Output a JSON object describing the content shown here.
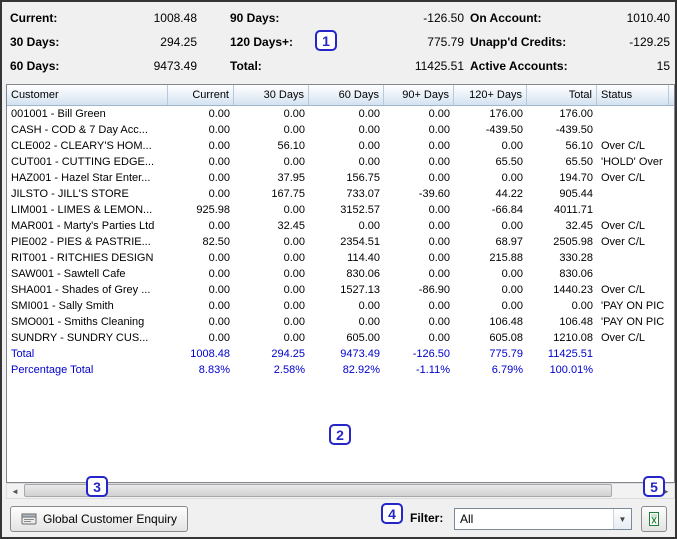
{
  "summary": {
    "items": [
      {
        "label": "Current:",
        "value": "1008.48"
      },
      {
        "label": "90 Days:",
        "value": "-126.50"
      },
      {
        "label": "On Account:",
        "value": "1010.40"
      },
      {
        "label": "30 Days:",
        "value": "294.25"
      },
      {
        "label": "120 Days+:",
        "value": "775.79"
      },
      {
        "label": "Unapp'd Credits:",
        "value": "-129.25"
      },
      {
        "label": "60 Days:",
        "value": "9473.49"
      },
      {
        "label": "Total:",
        "value": "11425.51"
      },
      {
        "label": "Active Accounts:",
        "value": "15"
      }
    ]
  },
  "table": {
    "columns": [
      "Customer",
      "Current",
      "30 Days",
      "60 Days",
      "90+ Days",
      "120+ Days",
      "Total",
      "Status"
    ],
    "keys": [
      "customer",
      "current",
      "d30",
      "d60",
      "d90",
      "d120",
      "total",
      "status"
    ],
    "aligns": [
      "left",
      "right",
      "right",
      "right",
      "right",
      "right",
      "right",
      "left"
    ],
    "rows": [
      {
        "customer": "001001 - Bill Green",
        "current": "0.00",
        "d30": "0.00",
        "d60": "0.00",
        "d90": "0.00",
        "d120": "176.00",
        "total": "176.00",
        "status": ""
      },
      {
        "customer": "CASH   - COD & 7 Day Acc...",
        "current": "0.00",
        "d30": "0.00",
        "d60": "0.00",
        "d90": "0.00",
        "d120": "-439.50",
        "total": "-439.50",
        "status": ""
      },
      {
        "customer": "CLE002 - CLEARY'S HOM...",
        "current": "0.00",
        "d30": "56.10",
        "d60": "0.00",
        "d90": "0.00",
        "d120": "0.00",
        "total": "56.10",
        "status": "Over C/L"
      },
      {
        "customer": "CUT001 - CUTTING EDGE...",
        "current": "0.00",
        "d30": "0.00",
        "d60": "0.00",
        "d90": "0.00",
        "d120": "65.50",
        "total": "65.50",
        "status": "'HOLD' Over"
      },
      {
        "customer": "HAZ001 - Hazel Star Enter...",
        "current": "0.00",
        "d30": "37.95",
        "d60": "156.75",
        "d90": "0.00",
        "d120": "0.00",
        "total": "194.70",
        "status": "Over C/L"
      },
      {
        "customer": "JILSTO - JILL'S STORE",
        "current": "0.00",
        "d30": "167.75",
        "d60": "733.07",
        "d90": "-39.60",
        "d120": "44.22",
        "total": "905.44",
        "status": ""
      },
      {
        "customer": "LIM001 - LIMES & LEMON...",
        "current": "925.98",
        "d30": "0.00",
        "d60": "3152.57",
        "d90": "0.00",
        "d120": "-66.84",
        "total": "4011.71",
        "status": ""
      },
      {
        "customer": "MAR001 - Marty's Parties Ltd",
        "current": "0.00",
        "d30": "32.45",
        "d60": "0.00",
        "d90": "0.00",
        "d120": "0.00",
        "total": "32.45",
        "status": "Over C/L"
      },
      {
        "customer": "PIE002 - PIES & PASTRIE...",
        "current": "82.50",
        "d30": "0.00",
        "d60": "2354.51",
        "d90": "0.00",
        "d120": "68.97",
        "total": "2505.98",
        "status": "Over C/L"
      },
      {
        "customer": "RIT001 - RITCHIES DESIGN",
        "current": "0.00",
        "d30": "0.00",
        "d60": "114.40",
        "d90": "0.00",
        "d120": "215.88",
        "total": "330.28",
        "status": ""
      },
      {
        "customer": "SAW001 - Sawtell Cafe",
        "current": "0.00",
        "d30": "0.00",
        "d60": "830.06",
        "d90": "0.00",
        "d120": "0.00",
        "total": "830.06",
        "status": ""
      },
      {
        "customer": "SHA001 - Shades of Grey ...",
        "current": "0.00",
        "d30": "0.00",
        "d60": "1527.13",
        "d90": "-86.90",
        "d120": "0.00",
        "total": "1440.23",
        "status": "Over C/L"
      },
      {
        "customer": "SMI001 - Sally Smith",
        "current": "0.00",
        "d30": "0.00",
        "d60": "0.00",
        "d90": "0.00",
        "d120": "0.00",
        "total": "0.00",
        "status": "'PAY ON PIC"
      },
      {
        "customer": "SMO001 - Smiths Cleaning",
        "current": "0.00",
        "d30": "0.00",
        "d60": "0.00",
        "d90": "0.00",
        "d120": "106.48",
        "total": "106.48",
        "status": "'PAY ON PIC"
      },
      {
        "customer": "SUNDRY - SUNDRY CUS...",
        "current": "0.00",
        "d30": "0.00",
        "d60": "605.00",
        "d90": "0.00",
        "d120": "605.08",
        "total": "1210.08",
        "status": "Over C/L"
      }
    ],
    "total_row": {
      "customer": "Total",
      "current": "1008.48",
      "d30": "294.25",
      "d60": "9473.49",
      "d90": "-126.50",
      "d120": "775.79",
      "total": "11425.51",
      "status": ""
    },
    "percent_row": {
      "customer": "Percentage Total",
      "current": "8.83%",
      "d30": "2.58%",
      "d60": "82.92%",
      "d90": "-1.11%",
      "d120": "6.79%",
      "total": "100.01%",
      "status": ""
    }
  },
  "footer": {
    "enquiry_button_label": "Global Customer Enquiry",
    "filter_label": "Filter:",
    "filter_value": "All"
  },
  "icons": {
    "scroll_left": "◄",
    "scroll_right": "►",
    "dropdown_arrow": "▼"
  },
  "annotations": [
    "1",
    "2",
    "3",
    "4",
    "5"
  ]
}
